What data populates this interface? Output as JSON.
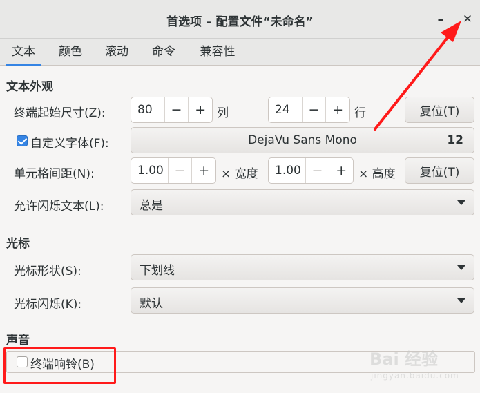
{
  "window": {
    "title": "首选项 – 配置文件“未命名”",
    "minimize_symbol": "–",
    "close_symbol": "✕"
  },
  "tabs": [
    {
      "label": "文本",
      "active": true
    },
    {
      "label": "颜色",
      "active": false
    },
    {
      "label": "滚动",
      "active": false
    },
    {
      "label": "命令",
      "active": false
    },
    {
      "label": "兼容性",
      "active": false
    }
  ],
  "text_appearance": {
    "heading": "文本外观",
    "initial_size": {
      "label": "终端起始尺寸(Z):",
      "columns": "80",
      "columns_unit": "列",
      "rows": "24",
      "rows_unit": "行",
      "reset_label": "复位(T)"
    },
    "custom_font": {
      "label": "自定义字体(F):",
      "checked": true,
      "font_name": "DejaVu Sans Mono",
      "font_size": "12"
    },
    "cell_spacing": {
      "label": "单元格间距(N):",
      "width": "1.00",
      "width_unit": "× 宽度",
      "height": "1.00",
      "height_unit": "× 高度",
      "reset_label": "复位(T)"
    },
    "blink_text": {
      "label": "允许闪烁文本(L):",
      "value": "总是"
    }
  },
  "cursor": {
    "heading": "光标",
    "shape": {
      "label": "光标形状(S):",
      "value": "下划线"
    },
    "blink": {
      "label": "光标闪烁(K):",
      "value": "默认"
    }
  },
  "sound": {
    "heading": "声音",
    "bell": {
      "label": "终端响铃(B)",
      "checked": false
    }
  },
  "annotation": {
    "highlight_color": "#ff1a1a",
    "arrow_color": "#ff1a1a"
  },
  "watermark": {
    "brand": "Bai  经验",
    "url": "jingyan.baidu.com"
  },
  "icons": {
    "minus": "−",
    "plus": "+"
  }
}
